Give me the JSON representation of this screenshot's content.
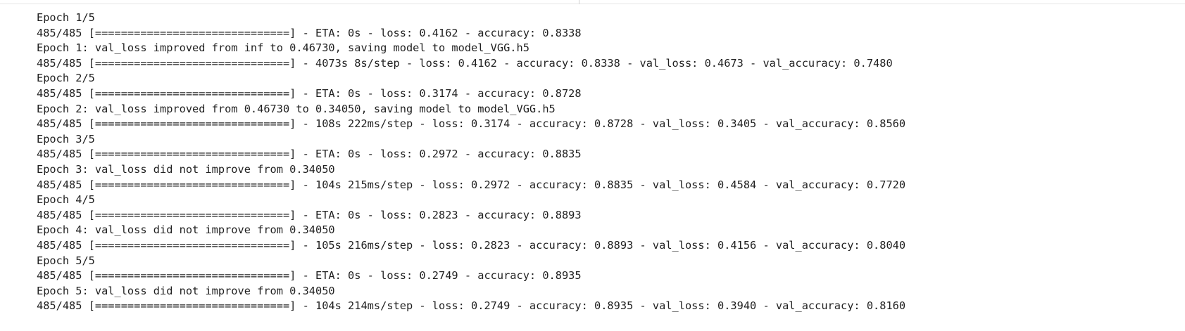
{
  "output": {
    "lines": [
      "Epoch 1/5",
      "485/485 [==============================] - ETA: 0s - loss: 0.4162 - accuracy: 0.8338",
      "Epoch 1: val_loss improved from inf to 0.46730, saving model to model_VGG.h5",
      "485/485 [==============================] - 4073s 8s/step - loss: 0.4162 - accuracy: 0.8338 - val_loss: 0.4673 - val_accuracy: 0.7480",
      "Epoch 2/5",
      "485/485 [==============================] - ETA: 0s - loss: 0.3174 - accuracy: 0.8728",
      "Epoch 2: val_loss improved from 0.46730 to 0.34050, saving model to model_VGG.h5",
      "485/485 [==============================] - 108s 222ms/step - loss: 0.3174 - accuracy: 0.8728 - val_loss: 0.3405 - val_accuracy: 0.8560",
      "Epoch 3/5",
      "485/485 [==============================] - ETA: 0s - loss: 0.2972 - accuracy: 0.8835",
      "Epoch 3: val_loss did not improve from 0.34050",
      "485/485 [==============================] - 104s 215ms/step - loss: 0.2972 - accuracy: 0.8835 - val_loss: 0.4584 - val_accuracy: 0.7720",
      "Epoch 4/5",
      "485/485 [==============================] - ETA: 0s - loss: 0.2823 - accuracy: 0.8893",
      "Epoch 4: val_loss did not improve from 0.34050",
      "485/485 [==============================] - 105s 216ms/step - loss: 0.2823 - accuracy: 0.8893 - val_loss: 0.4156 - val_accuracy: 0.8040",
      "Epoch 5/5",
      "485/485 [==============================] - ETA: 0s - loss: 0.2749 - accuracy: 0.8935",
      "Epoch 5: val_loss did not improve from 0.34050",
      "485/485 [==============================] - 104s 214ms/step - loss: 0.2749 - accuracy: 0.8935 - val_loss: 0.3940 - val_accuracy: 0.8160"
    ]
  }
}
